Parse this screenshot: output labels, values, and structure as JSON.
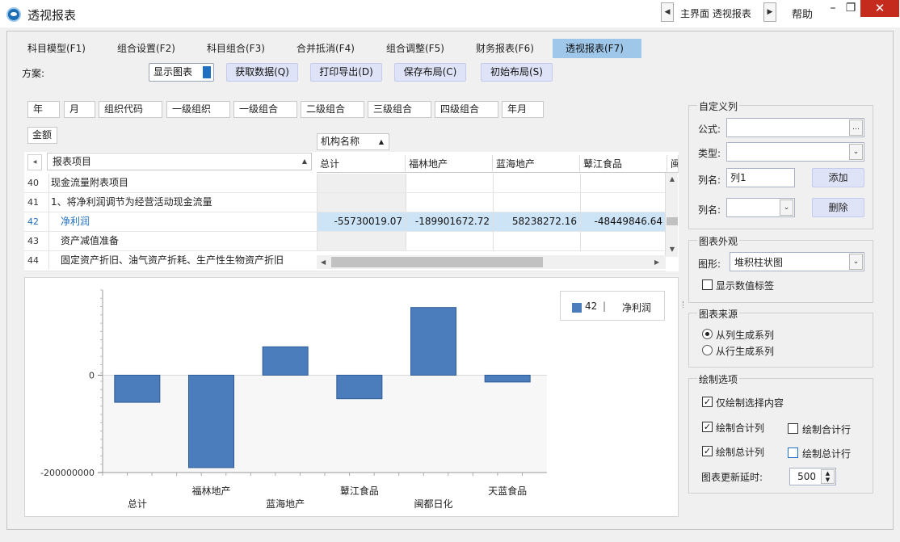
{
  "window": {
    "title": "透视报表",
    "breadcrumb": "主界面 透视报表",
    "help": "帮助"
  },
  "tabs": [
    {
      "label": "科目模型(F1)"
    },
    {
      "label": "组合设置(F2)"
    },
    {
      "label": "科目组合(F3)"
    },
    {
      "label": "合并抵消(F4)"
    },
    {
      "label": "组合调整(F5)"
    },
    {
      "label": "财务报表(F6)"
    },
    {
      "label": "透视报表(F7)"
    }
  ],
  "toolbar": {
    "plan_label": "方案:",
    "show_chart": "显示图表",
    "fetch": "获取数据(Q)",
    "print": "打印导出(D)",
    "save_layout": "保存布局(C)",
    "init_layout": "初始布局(S)"
  },
  "fields": [
    "年",
    "月",
    "组织代码",
    "一级组织",
    "一级组合",
    "二级组合",
    "三级组合",
    "四级组合",
    "年月"
  ],
  "amount_field": "金额",
  "institution_header": "机构名称",
  "item_header": "报表项目",
  "columns": [
    "总计",
    "福林地产",
    "蓝海地产",
    "鼙江食品",
    "闽"
  ],
  "rows": [
    {
      "num": "40",
      "label": "现金流量附表项目",
      "values": [
        "",
        "",
        "",
        ""
      ]
    },
    {
      "num": "41",
      "label": "1、将净利润调节为经营活动现金流量",
      "values": [
        "",
        "",
        "",
        ""
      ]
    },
    {
      "num": "42",
      "label": "净利润",
      "values": [
        "-55730019.07",
        "-189901672.72",
        "58238272.16",
        "-48449846.64"
      ]
    },
    {
      "num": "43",
      "label": "资产减值准备",
      "values": [
        "",
        "",
        "",
        ""
      ]
    },
    {
      "num": "44",
      "label": "固定资产折旧、油气资产折耗、生产性生物资产折旧",
      "values": [
        "",
        "",
        "",
        ""
      ]
    }
  ],
  "chart_data": {
    "type": "bar",
    "categories": [
      "总计",
      "福林地产",
      "蓝海地产",
      "鼙江食品",
      "闽都日化",
      "天蓝食品"
    ],
    "series": [
      {
        "name": "42 | 净利润",
        "values": [
          -55730019.07,
          -189901672.72,
          58238272.16,
          -48449846.64,
          139000000,
          -14000000
        ]
      }
    ],
    "ylim": [
      -200000000,
      175000000
    ],
    "yticks": [
      {
        "value": 0,
        "label": "0"
      },
      {
        "value": -200000000,
        "label": "-200000000"
      }
    ],
    "legend": {
      "index": "42",
      "sep": "|",
      "name": "净利润"
    },
    "bar_color": "#4b7dbd"
  },
  "panel": {
    "custom_col": {
      "caption": "自定义列",
      "formula_label": "公式:",
      "type_label": "类型:",
      "colname_label": "列名:",
      "colname_value": "列1",
      "add": "添加",
      "colname2_label": "列名:",
      "delete": "删除"
    },
    "appearance": {
      "caption": "图表外观",
      "shape_label": "图形:",
      "shape_value": "堆积柱状图",
      "show_labels": "显示数值标签"
    },
    "source": {
      "caption": "图表来源",
      "from_cols": "从列生成系列",
      "from_rows": "从行生成系列"
    },
    "draw": {
      "caption": "绘制选项",
      "only_selected": "仅绘制选择内容",
      "draw_sum_col": "绘制合计列",
      "draw_sum_row": "绘制合计行",
      "draw_total_col": "绘制总计列",
      "draw_total_row": "绘制总计行",
      "delay_label": "图表更新延时:",
      "delay_value": "500"
    }
  }
}
